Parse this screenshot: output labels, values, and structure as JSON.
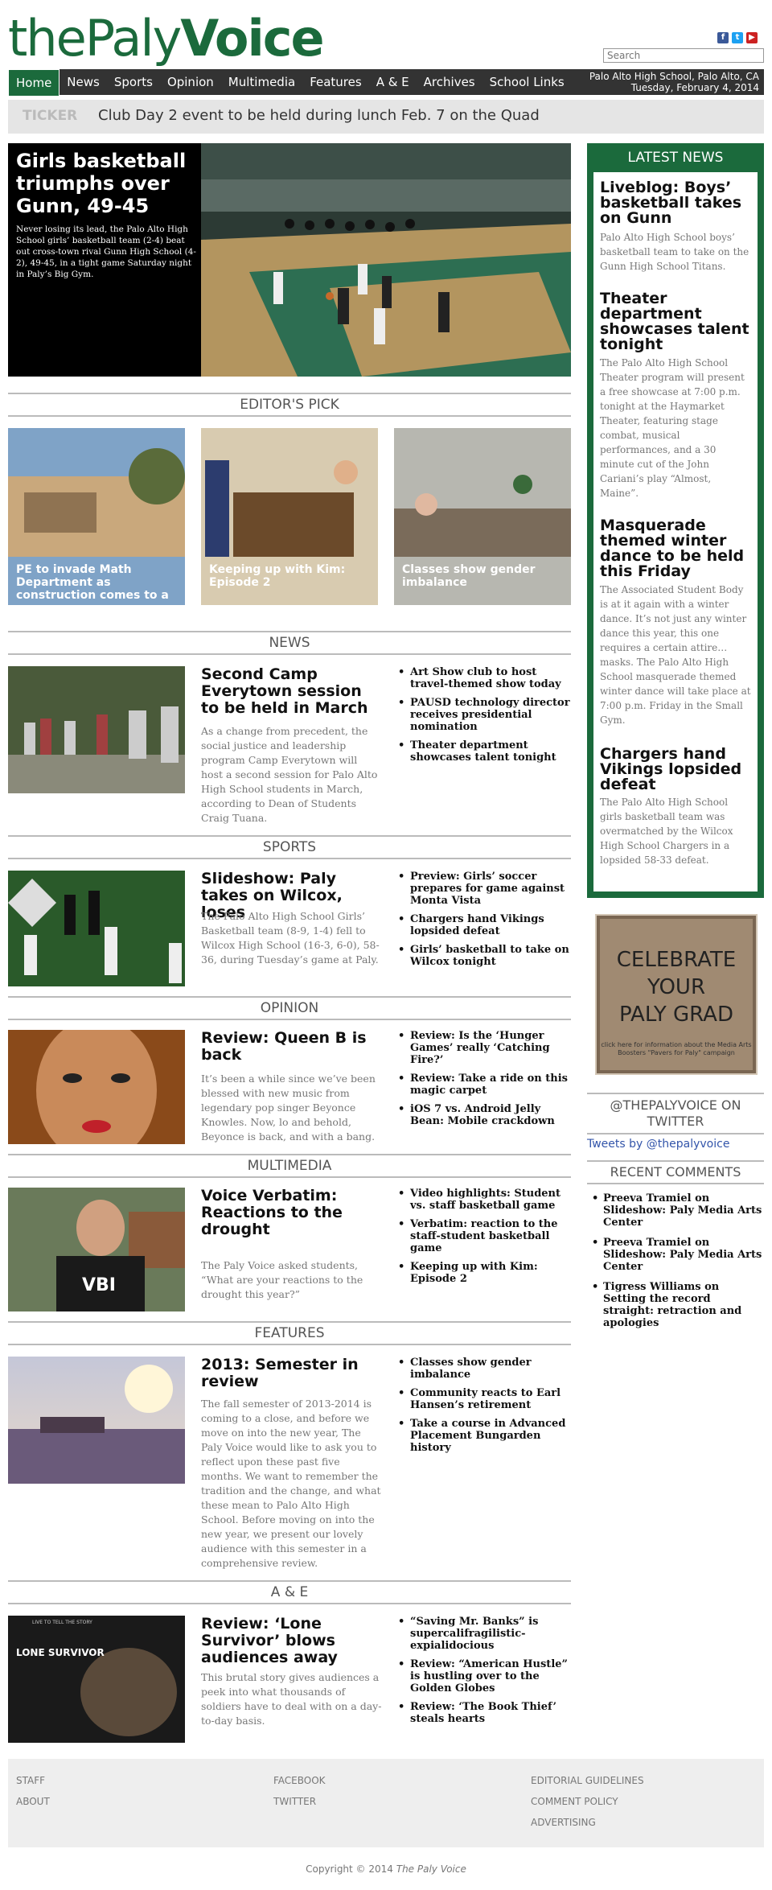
{
  "logo": {
    "part1": "the",
    "part2": "Paly",
    "part3": "Voice"
  },
  "social": [
    "facebook-icon",
    "twitter-icon",
    "youtube-icon"
  ],
  "search": {
    "placeholder": "Search"
  },
  "nav": {
    "items": [
      "Home",
      "News",
      "Sports",
      "Opinion",
      "Multimedia",
      "Features",
      "A & E",
      "Archives",
      "School Links"
    ],
    "location": "Palo Alto High School, Palo Alto, CA",
    "date": "Tuesday, February 4, 2014"
  },
  "ticker": {
    "label": "TICKER",
    "text": "Club Day 2 event to be held during lunch Feb. 7 on the Quad"
  },
  "hero": {
    "title": "Girls basketball triumphs over Gunn, 49-45",
    "summary": "Never losing its lead, the Palo Alto High School girls’ basketball team (2-4) beat out cross-town rival Gunn High School (4-2), 49-45, in a tight game Saturday night in Paly’s Big Gym."
  },
  "editors_pick": {
    "heading": "EDITOR'S PICK",
    "items": [
      "PE to invade Math Department as construction comes to a",
      "Keeping up with Kim: Episode 2",
      "Classes show gender imbalance"
    ]
  },
  "news": {
    "heading": "NEWS",
    "title": "Second Camp Everytown session to be held in March",
    "body": "As a change from precedent, the social justice and leadership program Camp Everytown will host a second session for Palo Alto High School students in March, according to Dean of Students Craig Tuana.",
    "links": [
      "Art Show club to host travel-themed show today",
      "PAUSD technology director receives presidential nomination",
      "Theater department showcases talent tonight"
    ]
  },
  "sports": {
    "heading": "SPORTS",
    "title": "Slideshow: Paly takes on Wilcox, loses",
    "body": "The Palo Alto High School Girls’ Basketball team (8-9, 1-4) fell to Wilcox High School (16-3, 6-0), 58-36, during Tuesday’s game at Paly.",
    "links": [
      "Preview: Girls’ soccer prepares for game against Monta Vista",
      "Chargers hand Vikings lopsided defeat",
      "Girls’ basketball to take on Wilcox tonight"
    ]
  },
  "opinion": {
    "heading": "OPINION",
    "title": "Review: Queen B is back",
    "body": "It’s been a while since we’ve been blessed with new music from legendary pop singer Beyonce Knowles. Now, lo and behold, Beyonce is back, and with a bang.",
    "links": [
      "Review: Is the ‘Hunger Games’ really ‘Catching Fire?’",
      "Review: Take a ride on this magic carpet",
      "iOS 7 vs. Android Jelly Bean: Mobile crackdown"
    ]
  },
  "multimedia": {
    "heading": "MULTIMEDIA",
    "title": "Voice Verbatim: Reactions to the drought",
    "body": "The Paly Voice asked students, “What are your reactions to the drought this year?”",
    "links": [
      "Video highlights: Student vs. staff basketball game",
      "Verbatim: reaction to the staff-student basketball game",
      "Keeping up with Kim: Episode 2"
    ],
    "shirt": "VBI"
  },
  "features": {
    "heading": "FEATURES",
    "title": "2013: Semester in review",
    "body": "The fall semester of 2013-2014 is coming to a close, and before we move on into the new year, The Paly Voice would like to ask you to reflect upon these past five months. We want to remember the tradition and the change, and what these mean to Palo Alto High School. Before moving on into the new year, we present our lovely audience with this semester in a comprehensive review.",
    "links": [
      "Classes show gender imbalance",
      "Community reacts to Earl Hansen’s retirement",
      "Take a course in Advanced Placement Bungarden history"
    ]
  },
  "ae": {
    "heading": "A & E",
    "title": "Review: ‘Lone Survivor’ blows audiences away",
    "body": "This brutal story gives audiences a peek into what thousands of soldiers have to deal with on a day-to-day basis.",
    "links": [
      "“Saving Mr. Banks” is supercalifragilistic-expialidocious",
      "Review: “American Hustle” is hustling over to the Golden Globes",
      "Review: ‘The Book Thief’ steals hearts"
    ],
    "poster_tag": "LIVE TO TELL THE STORY",
    "poster_title": "LONE SURVIVOR"
  },
  "latest": {
    "heading": "LATEST NEWS",
    "items": [
      {
        "title": "Liveblog: Boys’ basketball takes on Gunn",
        "body": "Palo Alto High School boys’ basketball team to take on the Gunn High School Titans."
      },
      {
        "title": "Theater department showcases talent tonight",
        "body": "The Palo Alto High School Theater program will present a free showcase at 7:00 p.m. tonight at the Haymarket Theater, featuring stage combat, musical performances, and a 30 minute cut of the John Cariani’s play “Almost, Maine”."
      },
      {
        "title": "Masquerade themed winter dance to be held this Friday",
        "body": "The Associated Student Body is at it again with a winter dance. It’s not just any winter dance this year, this one requires a certain attire… masks. The Palo Alto High School masquerade themed winter dance will take place at 7:00 p.m. Friday in the Small Gym."
      },
      {
        "title": "Chargers hand Vikings lopsided defeat",
        "body": "The Palo Alto High School girls basketball team was overmatched by the Wilcox High School Chargers in a lopsided 58-33 defeat."
      }
    ]
  },
  "ad": {
    "line1": "CELEBRATE",
    "line2": "YOUR",
    "line3": "PALY GRAD",
    "small": "click here for information about the Media Arts Boosters \"Pavers for Paly\" campaign"
  },
  "twitter": {
    "heading": "@THEPALYVOICE ON TWITTER",
    "link": "Tweets by @thepalyvoice"
  },
  "recent_comments": {
    "heading": "RECENT COMMENTS",
    "items": [
      "Preeva Tramiel on Slideshow: Paly Media Arts Center",
      "Preeva Tramiel on Slideshow: Paly Media Arts Center",
      "Tigress Williams on Setting the record straight: retraction and apologies"
    ]
  },
  "footer": {
    "col1": [
      "STAFF",
      "ABOUT"
    ],
    "col2": [
      "FACEBOOK",
      "TWITTER"
    ],
    "col3": [
      "EDITORIAL GUIDELINES",
      "COMMENT POLICY",
      "ADVERTISING"
    ],
    "copyright_prefix": "Copyright © 2014 ",
    "copyright_name": "The Paly Voice"
  },
  "colors": {
    "brand": "#1b6a3c",
    "nav": "#333333",
    "ticker": "#e5e5e5"
  }
}
